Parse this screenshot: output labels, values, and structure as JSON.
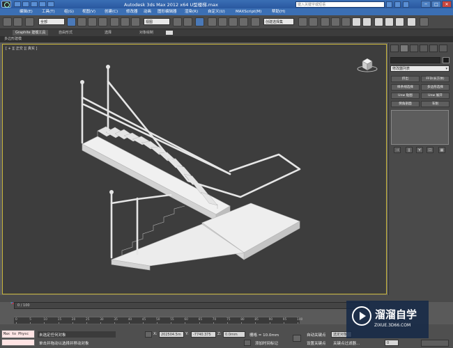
{
  "titlebar": {
    "title": "Autodesk 3ds Max  2012 x64      U型楼梯.max",
    "search_placeholder": "键入关键字或短语",
    "minimize": "─",
    "maximize": "□",
    "close": "✕"
  },
  "menu": [
    "编辑(E)",
    "工具(T)",
    "组(G)",
    "视图(V)",
    "创建(C)",
    "修改器",
    "动画",
    "图形编辑器",
    "渲染(R)",
    "自定义(U)",
    "MAXScript(M)",
    "帮助(H)"
  ],
  "toolbar": {
    "selection_filter": "全部",
    "ref_coord": "视图",
    "named_selection": "创建选择集"
  },
  "ribbon": {
    "tabs": [
      "Graphite 建模工具",
      "自由形式",
      "选择",
      "对象绘制"
    ],
    "panel_label": "多边形建模"
  },
  "viewport": {
    "label": "[ + ][ 正交 ][ 真实 ]"
  },
  "command_panel": {
    "modifier_list": "修改器列表",
    "buttons": [
      "挤出",
      "FFD(长方体)",
      "样条线选择",
      "多边形选择",
      "Unw 贴图",
      "Unw 展开",
      "倒角剖面",
      "车削"
    ],
    "stack_icons": [
      "⊣",
      "∥",
      "∀",
      "☐",
      "▦"
    ]
  },
  "timeline": {
    "slider": "0 / 100",
    "ticks": [
      "0",
      "5",
      "10",
      "15",
      "20",
      "25",
      "30",
      "35",
      "40",
      "45",
      "50",
      "55",
      "60",
      "65",
      "70",
      "75",
      "80",
      "85",
      "90",
      "95",
      "100"
    ]
  },
  "status": {
    "maxscript": "Max to Physc",
    "prompt1": "未选定任何对象",
    "prompt2": "单击并拖动以选择并移动对象",
    "x_label": "X:",
    "x_value": "202504.5m",
    "y_label": "Y:",
    "y_value": "-7740.375",
    "z_label": "Z:",
    "z_value": "0.0mm",
    "grid": "栅格 = 10.0mm",
    "add_time_tag": "添加时间标记",
    "auto_key": "自动关键点",
    "set_key": "设置关键点",
    "selected": "选定对象",
    "key_filters": "关键点过滤器...",
    "frame": "0"
  },
  "watermark": {
    "title": "溜溜自学",
    "url": "ZIXUE.3D66.COM"
  },
  "colors": {
    "titlebar": "#3a6fb5",
    "viewport_bg": "#3d3d3d",
    "viewport_border": "#c9b53a",
    "model": "#e8e8e8"
  }
}
